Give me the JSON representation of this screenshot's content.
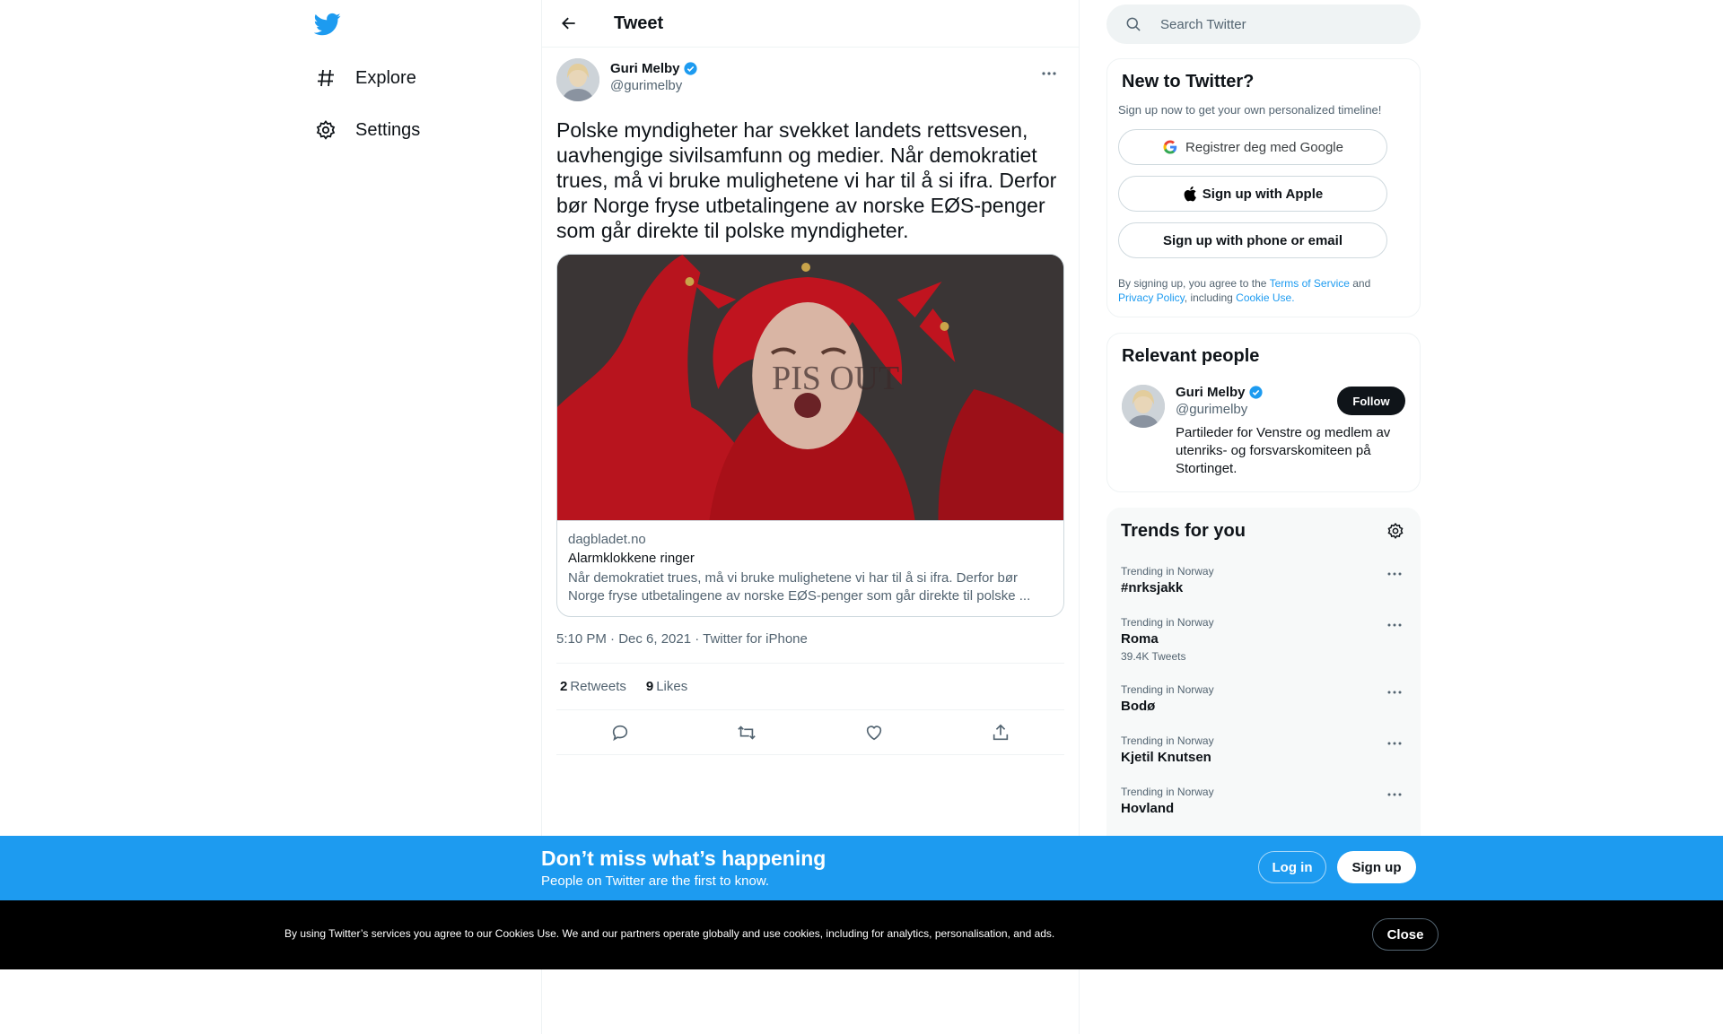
{
  "nav": {
    "logo_icon": "twitter-bird-icon",
    "items": [
      {
        "label": "Explore",
        "icon": "hashtag-icon"
      },
      {
        "label": "Settings",
        "icon": "gear-icon"
      }
    ]
  },
  "header": {
    "title": "Tweet"
  },
  "tweet": {
    "author_name": "Guri Melby",
    "author_handle": "@gurimelby",
    "text": "Polske myndigheter har svekket landets rettsvesen, uavhengige sivilsamfunn og medier. Når demokratiet trues, må vi bruke mulighetene vi har til å si ifra. Derfor bør Norge fryse utbetalingene av norske EØS-penger som går direkte til polske myndigheter.",
    "card": {
      "domain": "dagbladet.no",
      "title": "Alarmklokkene ringer",
      "description": "Når demokratiet trues, må vi bruke mulighetene vi har til å si ifra. Derfor bør\nNorge fryse utbetalingene av norske EØS-penger som går direkte til polske ..."
    },
    "meta": "5:10 PM · Dec 6, 2021 · Twitter for iPhone",
    "retweets_count": "2",
    "retweets_label": "Retweets",
    "likes_count": "9",
    "likes_label": "Likes"
  },
  "search": {
    "placeholder": "Search Twitter"
  },
  "new_to_twitter": {
    "title": "New to Twitter?",
    "subtitle": "Sign up now to get your own personalized timeline!",
    "google_label": "Registrer deg med Google",
    "apple_label": "Sign up with Apple",
    "phone_label": "Sign up with phone or email",
    "legal_prefix": "By signing up, you agree to the ",
    "terms": "Terms of Service",
    "and": " and",
    "privacy": "Privacy Policy",
    "including": ", including ",
    "cookie": "Cookie Use."
  },
  "relevant": {
    "title": "Relevant people",
    "name": "Guri Melby",
    "handle": "@gurimelby",
    "bio": "Partileder for Venstre og medlem av utenriks- og forsvarskomiteen på Stortinget.",
    "follow_label": "Follow"
  },
  "trends": {
    "title": "Trends for you",
    "items": [
      {
        "context": "Trending in Norway",
        "name": "#nrksjakk",
        "count": ""
      },
      {
        "context": "Trending in Norway",
        "name": "Roma",
        "count": "39.4K Tweets"
      },
      {
        "context": "Trending in Norway",
        "name": "Bodø",
        "count": ""
      },
      {
        "context": "Trending in Norway",
        "name": "Kjetil Knutsen",
        "count": ""
      },
      {
        "context": "Trending in Norway",
        "name": "Hovland",
        "count": ""
      }
    ]
  },
  "signup_bar": {
    "headline": "Don’t miss what’s happening",
    "sub": "People on Twitter are the first to know.",
    "login_label": "Log in",
    "signup_label": "Sign up"
  },
  "cookie_bar": {
    "text": "By using Twitter’s services you agree to our Cookies Use. We and our partners operate globally and use cookies, including for analytics, personalisation, and ads.",
    "close_label": "Close"
  },
  "colors": {
    "accent": "#1d9bf0",
    "text": "#0f1419",
    "secondary": "#536471"
  }
}
